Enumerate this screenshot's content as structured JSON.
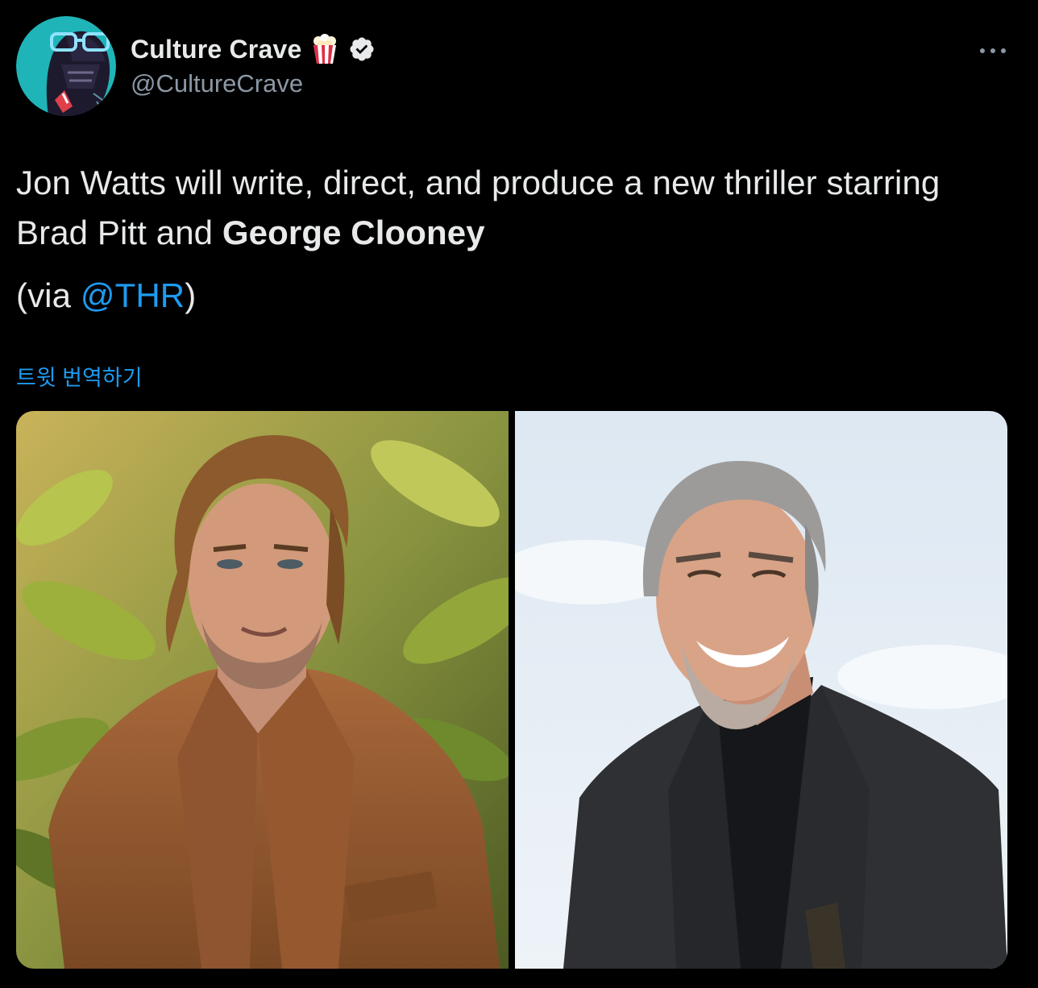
{
  "author": {
    "display_name": "Culture Crave",
    "emoji": "🍿",
    "handle": "@CultureCrave",
    "verified": true,
    "avatar_icon": "darth-vader-glasses-avatar"
  },
  "tweet": {
    "text_plain": "Jon Watts will write, direct, and produce a new thriller starring Brad Pitt and ",
    "text_bold": "George Clooney",
    "via_prefix": "(via ",
    "via_mention": "@THR",
    "via_suffix": ")",
    "translate_label": "트윗 번역하기"
  },
  "media": [
    {
      "icon": "photo-man-brown-coat-leaves"
    },
    {
      "icon": "photo-man-grey-hair-dark-suit"
    }
  ],
  "colors": {
    "background": "#000000",
    "text": "#e7e9ea",
    "secondary": "#8b98a5",
    "accent": "#1d9bf0"
  }
}
